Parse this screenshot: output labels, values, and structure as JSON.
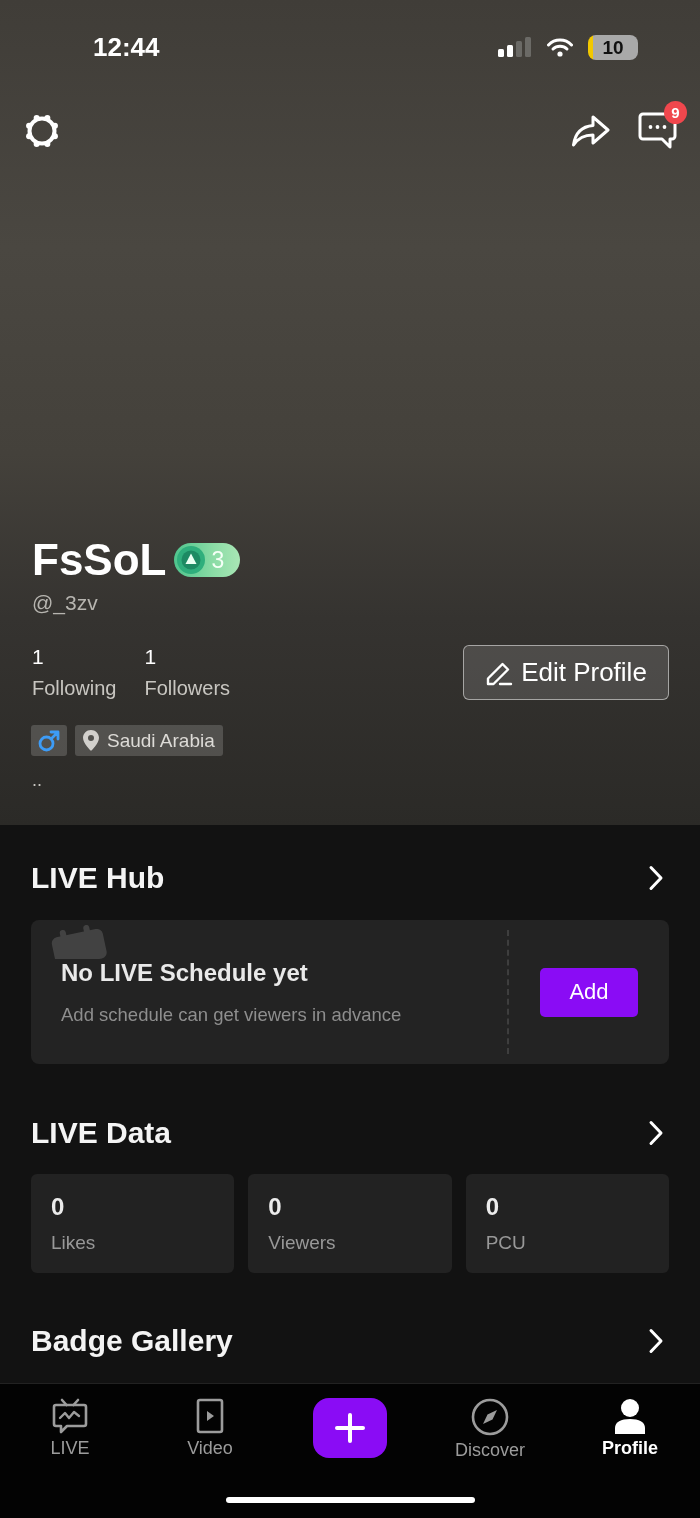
{
  "status_bar": {
    "time": "12:44",
    "battery": "10"
  },
  "top_bar": {
    "message_badge": "9"
  },
  "profile": {
    "name": "FsSoL",
    "level": "3",
    "handle": "@_3zv",
    "stats": [
      {
        "value": "1",
        "label": "Following"
      },
      {
        "value": "1",
        "label": "Followers"
      }
    ],
    "edit_button": "Edit Profile",
    "tags": [
      {
        "kind": "gender"
      },
      {
        "kind": "location",
        "label": "Saudi Arabia"
      }
    ],
    "bio": ".."
  },
  "live_hub": {
    "title": "LIVE Hub",
    "schedule": {
      "title": "No LIVE Schedule yet",
      "subtitle": "Add schedule can get viewers in advance",
      "button": "Add"
    }
  },
  "live_data": {
    "title": "LIVE Data",
    "stats": [
      {
        "value": "0",
        "label": "Likes"
      },
      {
        "value": "0",
        "label": "Viewers"
      },
      {
        "value": "0",
        "label": "PCU"
      }
    ]
  },
  "badge_gallery": {
    "title": "Badge Gallery"
  },
  "tab_bar": {
    "items": [
      {
        "kind": "tab",
        "label": "LIVE",
        "selected": false
      },
      {
        "kind": "tab",
        "label": "Video",
        "selected": false
      },
      {
        "kind": "create"
      },
      {
        "kind": "tab",
        "label": "Discover",
        "selected": false
      },
      {
        "kind": "tab",
        "label": "Profile",
        "selected": true
      }
    ]
  }
}
